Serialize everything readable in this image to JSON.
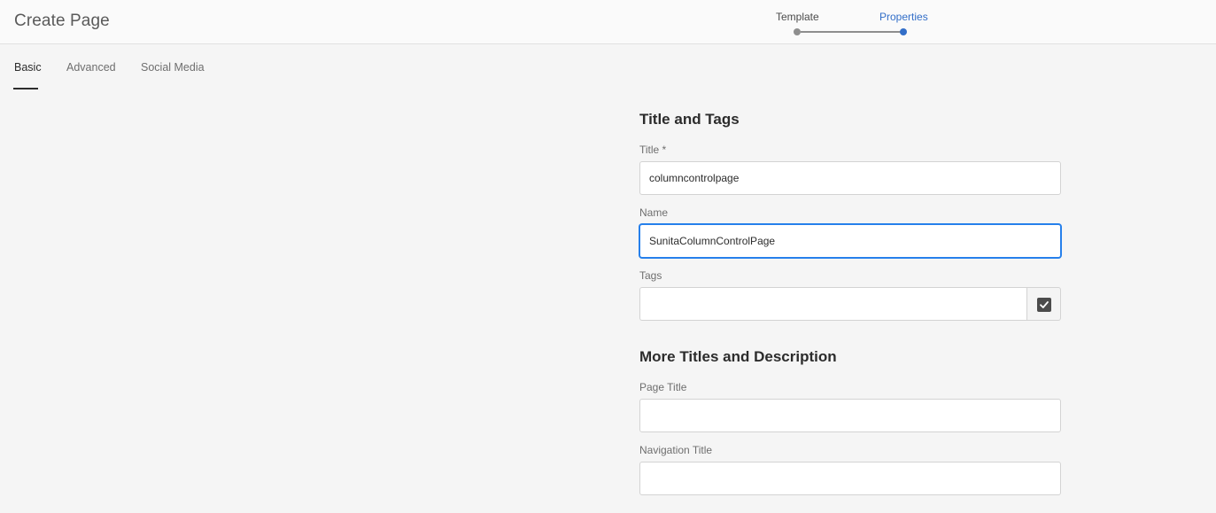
{
  "header": {
    "title": "Create Page",
    "wizard": {
      "steps": [
        {
          "label": "Template",
          "state": "completed"
        },
        {
          "label": "Properties",
          "state": "current"
        }
      ]
    }
  },
  "tabs": [
    {
      "label": "Basic",
      "active": true
    },
    {
      "label": "Advanced",
      "active": false
    },
    {
      "label": "Social Media",
      "active": false
    }
  ],
  "form": {
    "sections": {
      "title_and_tags": "Title and Tags",
      "more_titles": "More Titles and Description"
    },
    "fields": {
      "title": {
        "label": "Title *",
        "value": "columncontrolpage"
      },
      "name": {
        "label": "Name",
        "value": "SunitaColumnControlPage"
      },
      "tags": {
        "label": "Tags",
        "value": "",
        "button_icon": "check-icon"
      },
      "page_title": {
        "label": "Page Title",
        "value": ""
      },
      "navigation_title": {
        "label": "Navigation Title",
        "value": ""
      }
    }
  },
  "colors": {
    "accent": "#326ec8",
    "focus": "#2680eb",
    "background": "#f5f5f5",
    "header_background": "#fafafa"
  }
}
